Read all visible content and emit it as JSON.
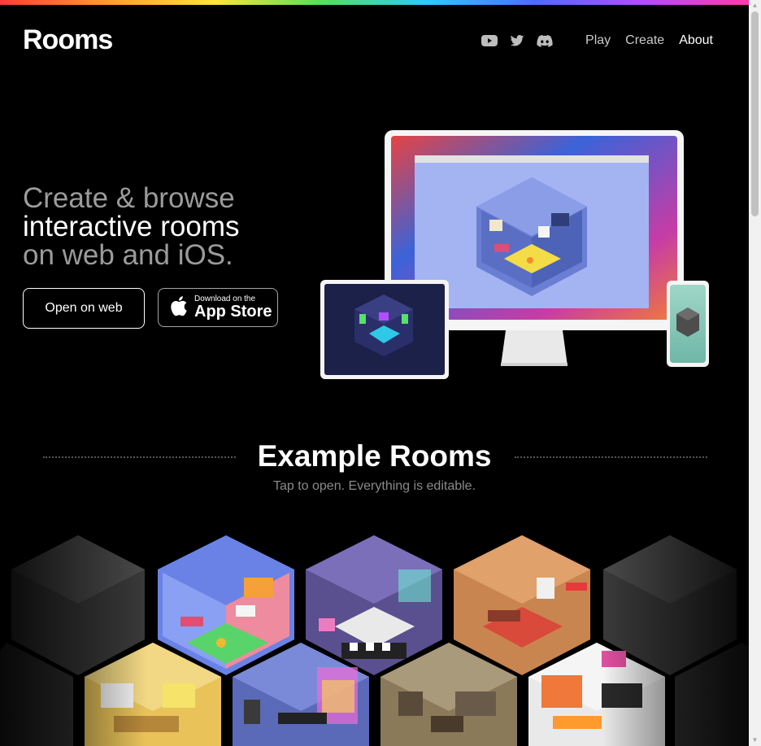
{
  "brand": {
    "name": "Rooms"
  },
  "nav": {
    "social": [
      "youtube-icon",
      "twitter-icon",
      "discord-icon"
    ],
    "links": [
      {
        "label": "Play",
        "active": false
      },
      {
        "label": "Create",
        "active": false
      },
      {
        "label": "About",
        "active": true
      }
    ]
  },
  "hero": {
    "line1": "Create & browse",
    "line2": "interactive rooms",
    "line3": "on web and iOS.",
    "open_web_label": "Open on web",
    "appstore_small": "Download on the",
    "appstore_big": "App Store"
  },
  "section": {
    "title": "Example Rooms",
    "subtitle": "Tap to open. Everything is editable."
  },
  "colors": {
    "background": "#000000",
    "muted_text": "#9b9b9b",
    "rainbow": [
      "#ff3b3b",
      "#ff9a2e",
      "#ffe53b",
      "#54e05b",
      "#2ec9ff",
      "#4f6bff",
      "#b14dff",
      "#ff3ba8"
    ]
  }
}
